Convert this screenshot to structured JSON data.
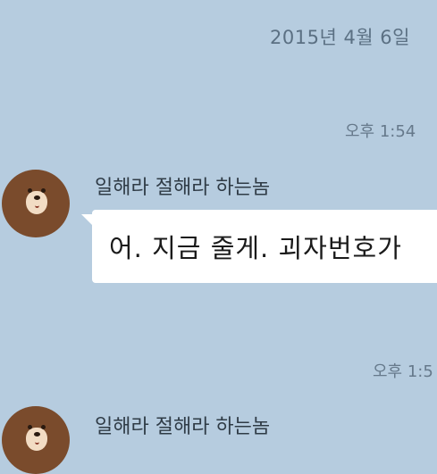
{
  "date_divider": "2015년 4월 6일 ",
  "messages": [
    {
      "time": "오후 1:54",
      "sender": "일해라 절해라 하는놈",
      "text": "어. 지금 줄게. 괴자번호가 "
    },
    {
      "time": "오후 1:5",
      "sender": "일해라 절해라 하는놈"
    }
  ],
  "colors": {
    "background": "#b6ccdf",
    "bubble": "#ffffff",
    "avatar": "#7a4b2c"
  },
  "icons": {
    "avatar": "brown-bear-icon"
  }
}
